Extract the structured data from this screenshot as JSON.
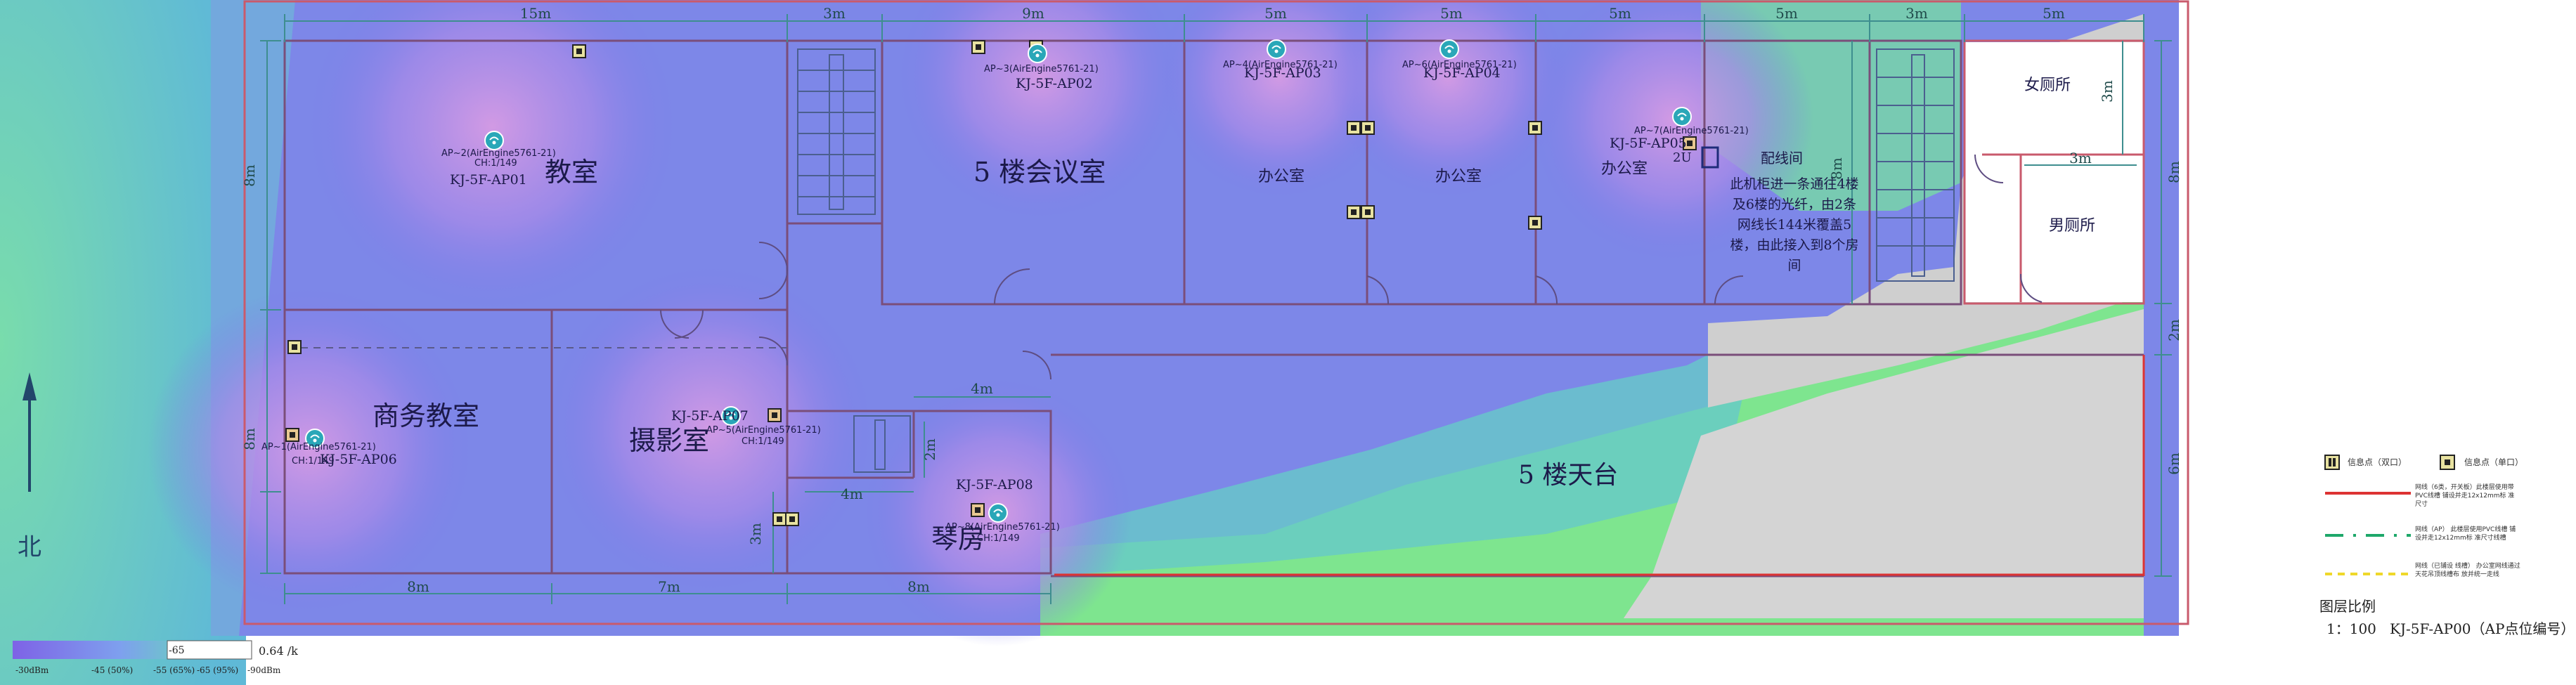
{
  "north_label": "北",
  "dimensions": {
    "top": [
      "15m",
      "3m",
      "9m",
      "5m",
      "5m",
      "5m",
      "5m",
      "3m",
      "5m"
    ],
    "bottom": [
      "8m",
      "7m",
      "8m"
    ],
    "left": [
      "8m",
      "8m",
      "3m"
    ],
    "inner_4m": "4m",
    "inner_2m": "2m",
    "inner_4m_stair": "4m",
    "right_toilet_3m": "3m",
    "right_toilet_3m_b": "3m",
    "right_8m": "8m",
    "right_2m": "2m",
    "right_6m": "6m",
    "cable_8m": "8m"
  },
  "rooms": {
    "classroom": "教室",
    "conference": "5 楼会议室",
    "office1": "办公室",
    "office2": "办公室",
    "office3": "办公室",
    "wiring": "配线间",
    "wiring_note": "此机柜进一条通往4楼及6楼的光纤，由2条网线长144米覆盖5楼，由此接入到8个房间",
    "female_wc": "女厕所",
    "male_wc": "男厕所",
    "business": "商务教室",
    "photo": "摄影室",
    "piano": "琴房",
    "terrace": "5 楼天台"
  },
  "aps": [
    {
      "id": "KJ-5F-AP01",
      "model": "AP~2(AirEngine5761-21)",
      "channel": "CH:1/149"
    },
    {
      "id": "KJ-5F-AP02",
      "model": "AP~3(AirEngine5761-21)",
      "channel": ""
    },
    {
      "id": "KJ-5F-AP03",
      "model": "AP~4(AirEngine5761-21)",
      "channel": ""
    },
    {
      "id": "KJ-5F-AP04",
      "model": "AP~6(AirEngine5761-21)",
      "channel": ""
    },
    {
      "id": "KJ-5F-AP05",
      "model": "AP~7(AirEngine5761-21)",
      "channel": ""
    },
    {
      "id": "KJ-5F-AP06",
      "model": "AP~1(AirEngine5761-21)",
      "channel": "CH:1/149"
    },
    {
      "id": "KJ-5F-AP07",
      "model": "AP~5(AirEngine5761-21)",
      "channel": "CH:1/149"
    },
    {
      "id": "KJ-5F-AP08",
      "model": "AP~8(AirEngine5761-21)",
      "channel": "CH:1/149"
    }
  ],
  "rack_label": "2U",
  "scale_bar": {
    "right_label": "0.64 /k",
    "ticks": [
      "-30dBm",
      "-45 (50%)",
      "-55 (65%)",
      "-65 (95%)",
      "-90dBm"
    ],
    "mid_label": "-65"
  },
  "legend": {
    "items": [
      {
        "symbol": "info-point-single",
        "label": "信息点（双口）"
      },
      {
        "symbol": "info-point-double",
        "label": "信息点（单口）"
      },
      {
        "symbol": "red-line",
        "label": "网线（6类，开关板）此楼层使用带PVC线槽 铺设并走12x12mm标 准尺寸"
      },
      {
        "symbol": "green-dash",
        "label": "网线（AP） 此楼层使用PVC线槽 铺设并走12x12mm标 准尺寸线槽"
      },
      {
        "symbol": "yellow-dash",
        "label": "网线（已铺设 线槽） 办公室网线通过 天花吊顶线槽布 放并统一走线"
      }
    ],
    "scale_title": "图层比例",
    "scale_value": "1：100",
    "ap_code": "KJ-5F-AP00（AP点位编号）"
  },
  "colors": {
    "wall": "#cc5a6a",
    "ap_icon": "#2aa7b8",
    "heat_strong": "#c58be0",
    "heat_mid": "#7d79ea",
    "heat_weak": "#62bfd6",
    "heat_low": "#7ee08e",
    "dim_line": "#3e8e8f",
    "terrace_gray": "#cfcfcf"
  }
}
